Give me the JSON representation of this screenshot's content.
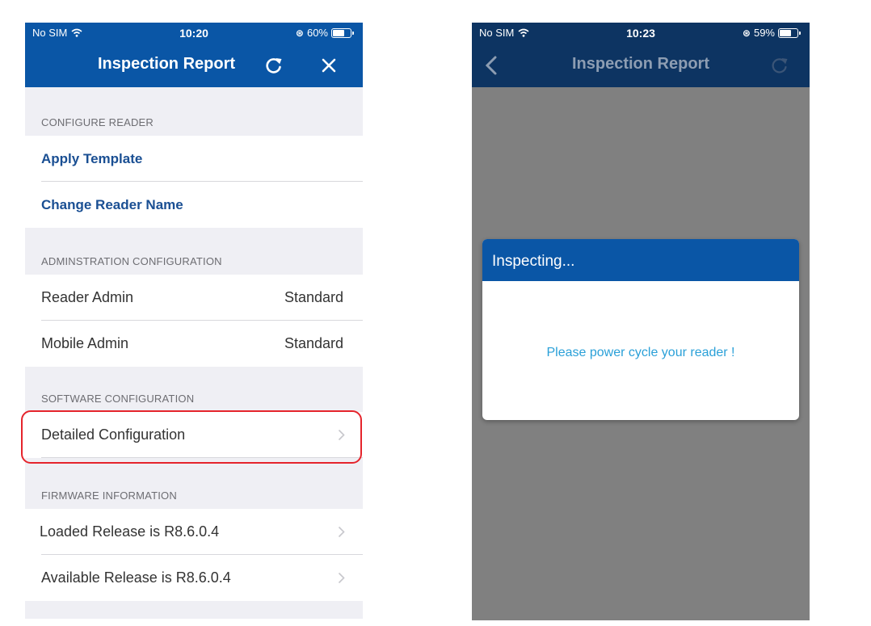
{
  "left_screen": {
    "status": {
      "carrier": "No SIM",
      "time": "10:20",
      "battery": "60%",
      "battery_level": 0.6
    },
    "title": "Inspection Report",
    "icons": {
      "refresh": "refresh-icon",
      "close": "close-icon"
    },
    "sections": [
      {
        "header": "CONFIGURE READER",
        "rows": [
          {
            "label": "Apply Template"
          },
          {
            "label": "Change Reader Name"
          }
        ]
      },
      {
        "header": "ADMINSTRATION CONFIGURATION",
        "rows": [
          {
            "label": "Reader Admin",
            "value": "Standard"
          },
          {
            "label": "Mobile Admin",
            "value": "Standard"
          }
        ]
      },
      {
        "header": "SOFTWARE CONFIGURATION",
        "rows": [
          {
            "label": "Detailed Configuration"
          }
        ]
      },
      {
        "header": "FIRMWARE INFORMATION",
        "rows": [
          {
            "label": "Loaded Release is R8.6.0.4"
          },
          {
            "label": "Available Release is R8.6.0.4"
          }
        ]
      }
    ],
    "highlight_color": "#e5242c"
  },
  "right_screen": {
    "status": {
      "carrier": "No SIM",
      "time": "10:23",
      "battery": "59%",
      "battery_level": 0.59
    },
    "title": "Inspection Report",
    "icons": {
      "back": "chevron-left-icon",
      "refresh": "refresh-icon"
    },
    "dialog": {
      "title": "Inspecting...",
      "message": "Please power cycle your reader !"
    }
  },
  "colors": {
    "nav_blue": "#0a56a6",
    "nav_dim": "#0d3462",
    "link_blue": "#1a4f93",
    "message_blue": "#2aa0d8",
    "overlay_gray": "#808080"
  }
}
